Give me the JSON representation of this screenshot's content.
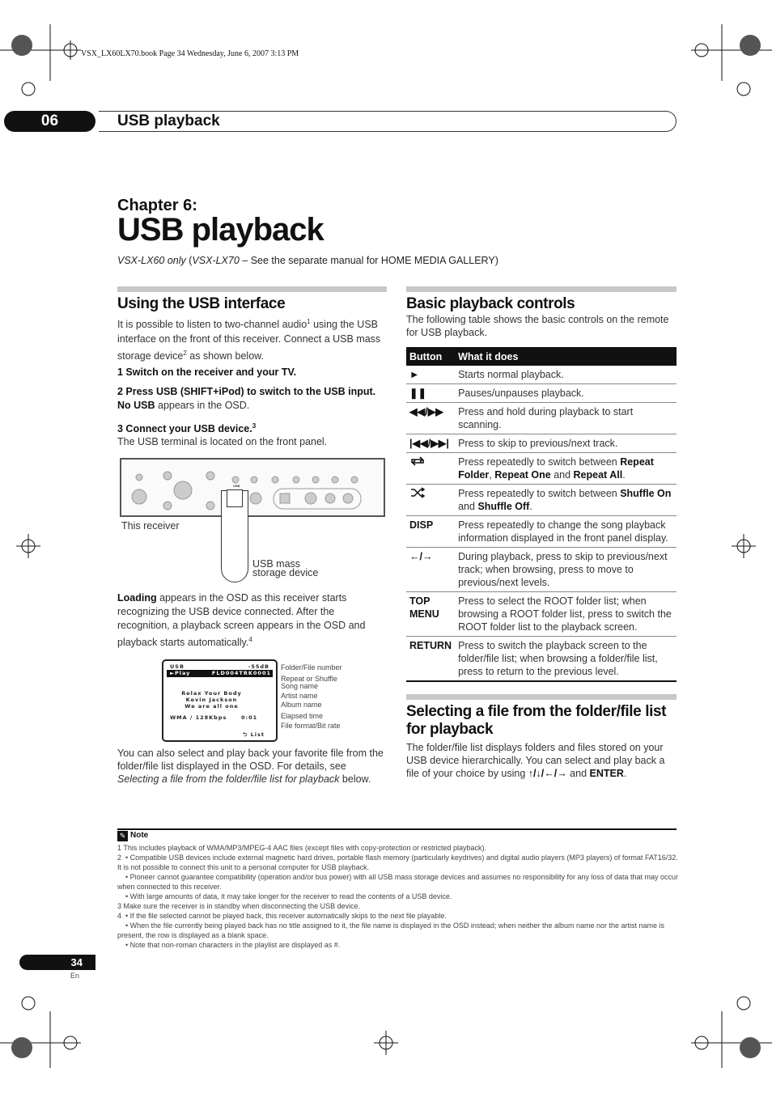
{
  "print_header": "VSX_LX60LX70.book  Page 34  Wednesday, June 6, 2007  3:13 PM",
  "chapter_tab": {
    "number": "06",
    "title": "USB playback"
  },
  "chapter_label": "Chapter 6:",
  "page_title": "USB playback",
  "subtitle": {
    "a": "VSX-LX60 only",
    "b": " (",
    "c": "VSX-LX70",
    "d": " – See the separate manual for HOME MEDIA GALLERY)"
  },
  "left": {
    "heading": "Using the USB interface",
    "intro": {
      "t1": "It is possible to listen to two-channel audio",
      "s1": "1",
      "t2": " using the USB interface on the front of this receiver. Connect a USB mass storage device",
      "s2": "2",
      "t3": " as shown below."
    },
    "step1": "1    Switch on the receiver and your TV.",
    "step2": "2    Press USB (SHIFT+iPod) to switch to the USB input.",
    "step2_b": "No USB",
    "step2_rest": " appears in the OSD.",
    "step3": "3    Connect your USB device.",
    "step3_sup": "3",
    "step3_text": "The USB terminal is located on the front panel.",
    "fig_receiver": "This receiver",
    "fig_device": "USB mass storage device",
    "fig_usb": "USB",
    "loading_b": "Loading",
    "loading_text": " appears in the OSD as this receiver starts recognizing the USB device connected. After the recognition, a playback screen appears in the OSD and playback starts automatically.",
    "loading_sup": "4",
    "osd": {
      "source": "USB",
      "volume": "-55dB",
      "status": "►Play",
      "file_no": "FLD004TRK0001",
      "song": "Relax Your Body",
      "artist": "Kevin Jackson",
      "album": "We are all one",
      "format": "WMA / 128Kbps",
      "time": "0:01",
      "list": "List"
    },
    "osd_labels": [
      "Folder/File number",
      "Repeat or Shuffle",
      "Song name",
      "Artist name",
      "Album name",
      "Elapsed time",
      "File format/Bit rate"
    ],
    "outro": "You can also select and play back your favorite file from the folder/file list displayed in the OSD. For details, see ",
    "outro_i": "Selecting a file from the folder/file list for playback",
    "outro_end": " below."
  },
  "right": {
    "heading": "Basic playback controls",
    "intro": "The following table shows the basic controls on the remote for USB playback.",
    "table": {
      "headers": [
        "Button",
        "What it does"
      ],
      "rows": [
        {
          "icon": "play-icon",
          "button": "►",
          "text": "Starts normal playback."
        },
        {
          "icon": "pause-icon",
          "button": "❚❚",
          "text": "Pauses/unpauses playback."
        },
        {
          "icon": "rewind-fastforward-icon",
          "button": "◀◀/▶▶",
          "text": "Press and hold during playback to start scanning."
        },
        {
          "icon": "skip-prev-next-icon",
          "button": "|◀◀/▶▶|",
          "text": "Press to skip to previous/next track."
        },
        {
          "icon": "repeat-icon",
          "button": "",
          "text": "Press repeatedly to switch between Repeat Folder, Repeat One and Repeat All."
        },
        {
          "icon": "shuffle-icon",
          "button": "",
          "text": "Press repeatedly to switch between Shuffle On and Shuffle Off."
        },
        {
          "icon": "",
          "button": "DISP",
          "text": "Press repeatedly to change the song playback information displayed in the front panel display."
        },
        {
          "icon": "left-right-arrows-icon",
          "button": "←/→",
          "text": "During playback, press to skip to previous/next track; when browsing, press to move to previous/next levels."
        },
        {
          "icon": "",
          "button": "TOP MENU",
          "text": "Press to select the ROOT folder list; when browsing a ROOT folder list, press to switch the ROOT folder list to the playback screen."
        },
        {
          "icon": "",
          "button": "RETURN",
          "text": "Press to switch the playback screen to the folder/file list; when browsing a folder/file list, press to return to the previous level."
        }
      ]
    },
    "heading2": "Selecting a file from the folder/file list for playback",
    "text2": "The folder/file list displays folders and files stored on your USB device hierarchically. You can select and play back a file of your choice by using ",
    "text2_arrows": "↑/↓/←/→",
    "text2_and": " and ",
    "text2_enter": "ENTER",
    "text2_end": "."
  },
  "note": {
    "title": "Note",
    "lines": [
      "1 This includes playback of WMA/MP3/MPEG-4 AAC files (except files with copy-protection or restricted playback).",
      "2  • Compatible USB devices include external magnetic hard drives, portable flash memory (particularly keydrives) and digital audio players (MP3 players) of format FAT16/32. It is not possible to connect this unit to a personal computer for USB playback.",
      "    • Pioneer cannot guarantee compatibility (operation and/or bus power) with all USB mass storage devices and assumes no responsibility for any loss of data that may occur when connected to this receiver.",
      "    • With large amounts of data, it may take longer for the receiver to read the contents of a USB device.",
      "3 Make sure the receiver is in standby when disconnecting the USB device.",
      "4  • If the file selected cannot be played back, this receiver automatically skips to the next file playable.",
      "    • When the file currently being played back has no title assigned to it, the file name is displayed in the OSD instead; when neither the album name nor the artist name is present, the row is displayed as a blank space.",
      "    • Note that non-roman characters in the playlist are displayed as #."
    ]
  },
  "page_number": "34",
  "language": "En"
}
